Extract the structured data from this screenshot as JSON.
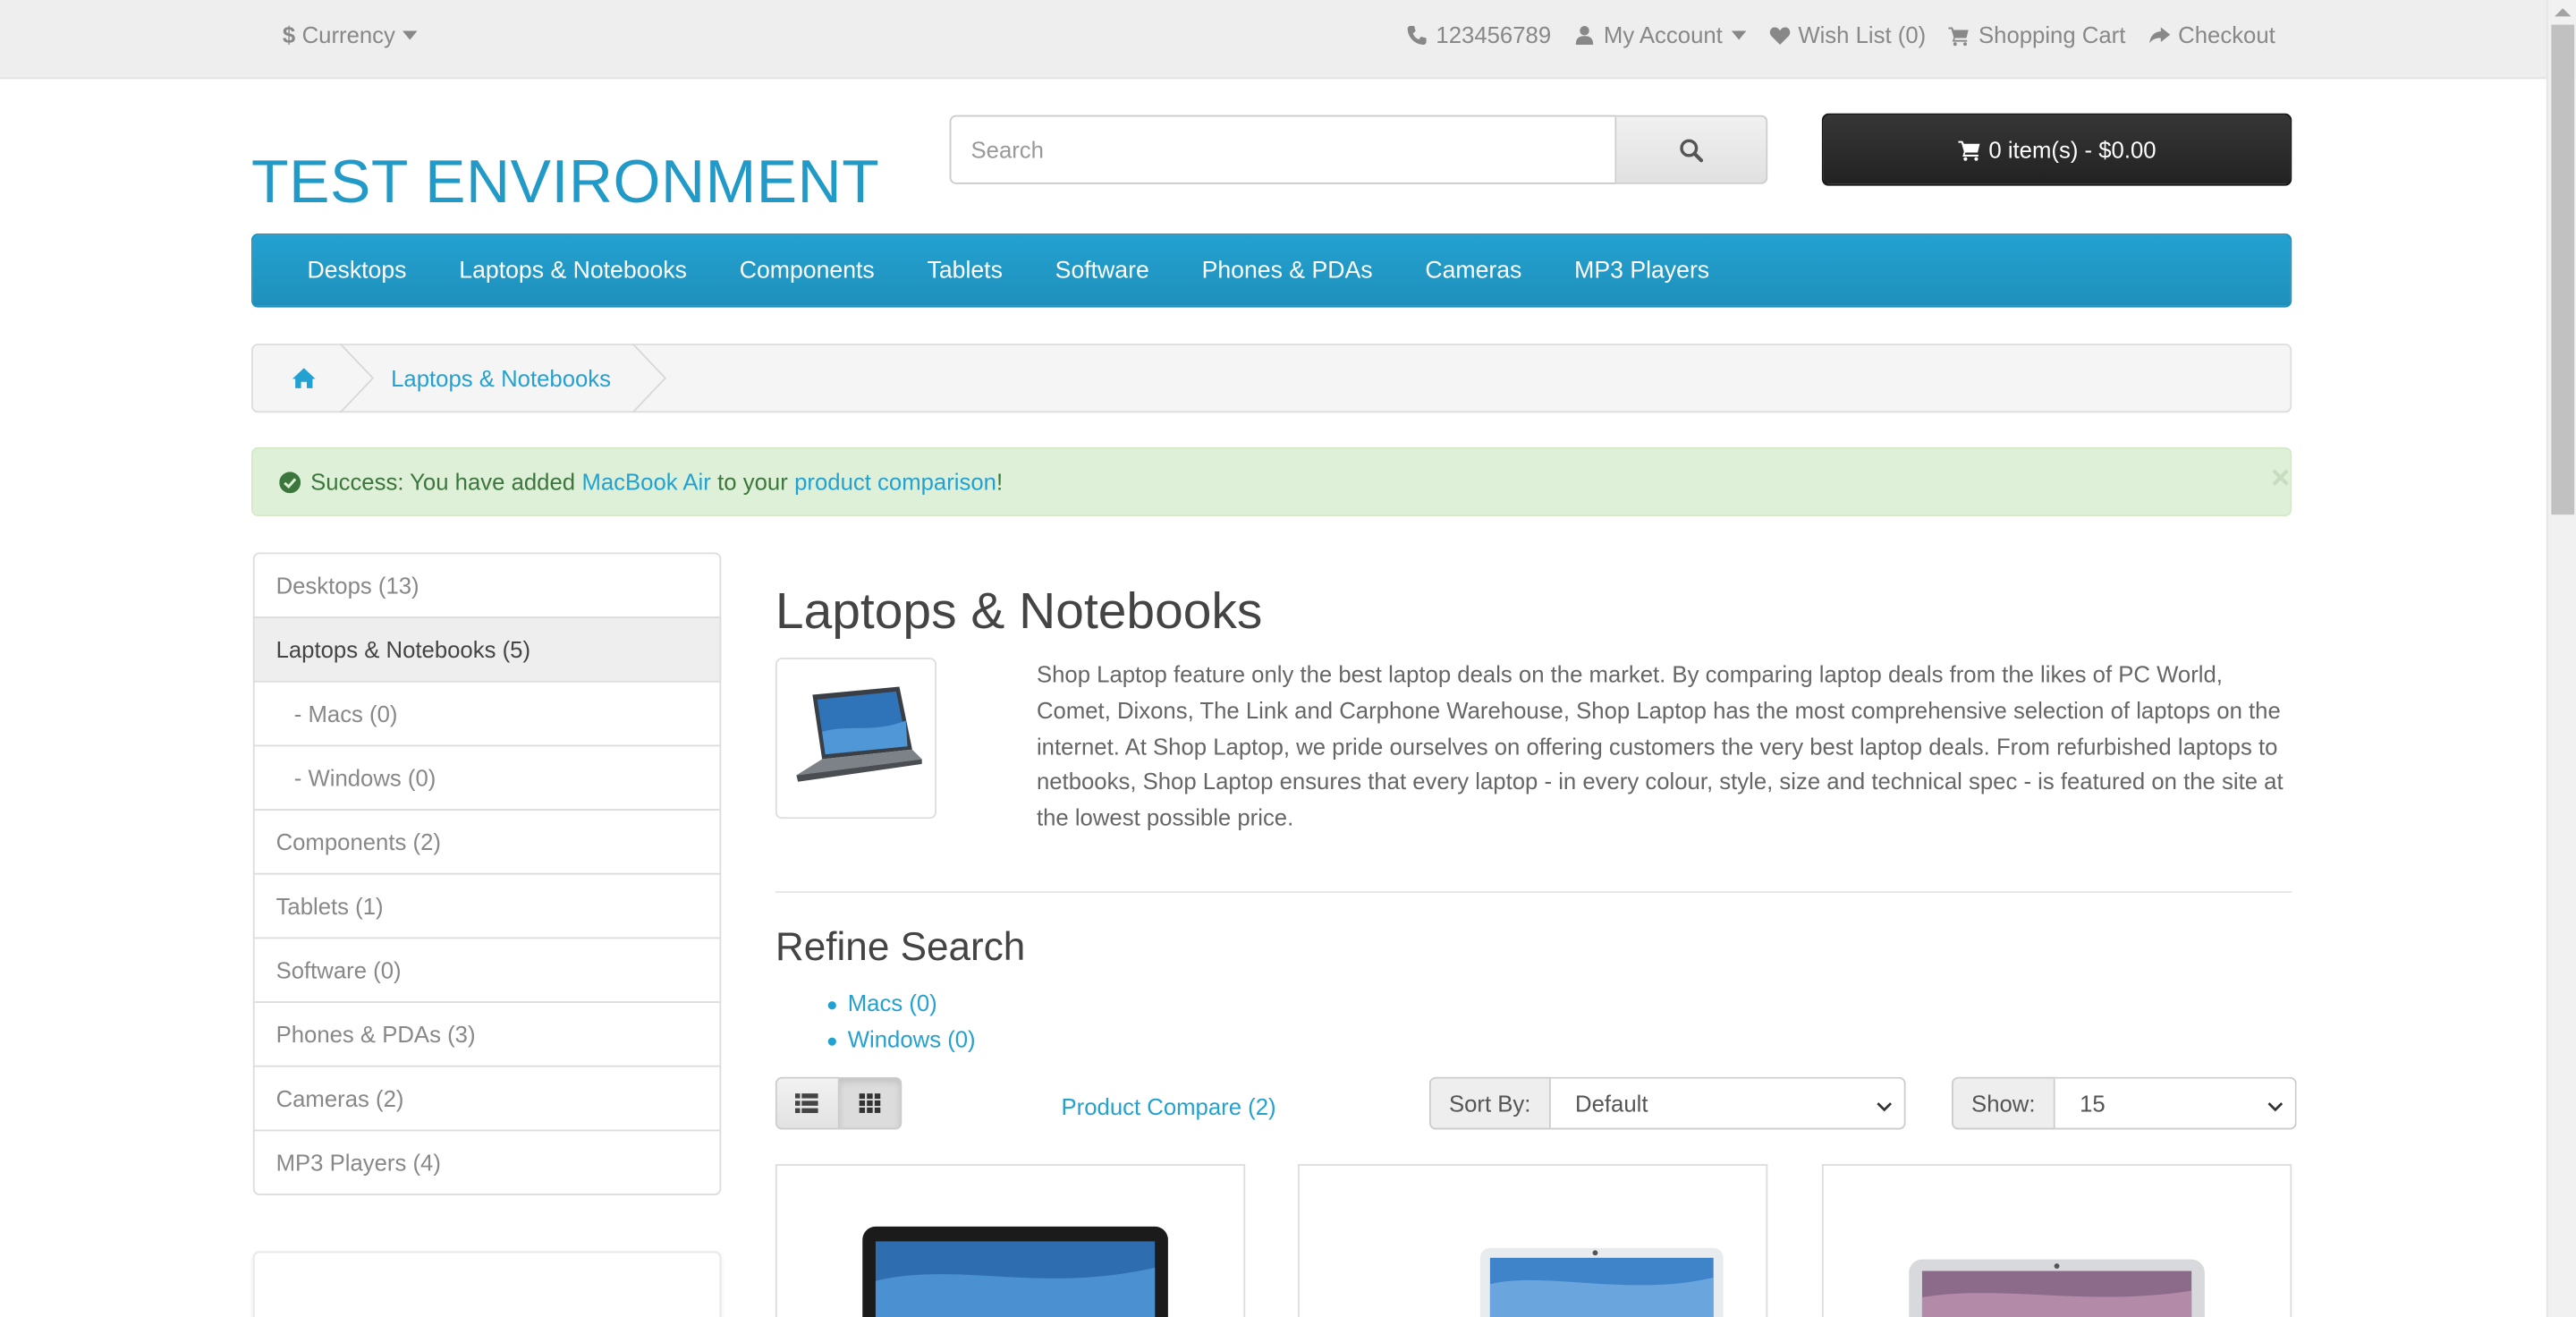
{
  "colors": {
    "accent": "#229ac8",
    "link": "#23a1d1",
    "menu_bg": "#229ac8",
    "cart_bg": "#303030",
    "alert_bg": "#dff0d8",
    "alert_text": "#3c763d"
  },
  "topbar": {
    "currency_icon": "dollar-icon",
    "currency_symbol": "$",
    "currency_label": "Currency",
    "phone": "123456789",
    "my_account": "My Account",
    "wishlist": "Wish List (0)",
    "shopping_cart": "Shopping Cart",
    "checkout": "Checkout"
  },
  "header": {
    "logo": "TEST ENVIRONMENT",
    "search_placeholder": "Search",
    "cart_label": "0 item(s) - $0.00"
  },
  "menu": {
    "items": [
      "Desktops",
      "Laptops & Notebooks",
      "Components",
      "Tablets",
      "Software",
      "Phones & PDAs",
      "Cameras",
      "MP3 Players"
    ]
  },
  "breadcrumb": {
    "home_icon": "home-icon",
    "current": "Laptops & Notebooks"
  },
  "alert": {
    "prefix": "Success: You have added",
    "product_link": "MacBook Air",
    "middle": "to your",
    "compare_link": "product comparison",
    "suffix": "!",
    "close": "×"
  },
  "sidebar": {
    "items": [
      {
        "label": "Desktops (13)"
      },
      {
        "label": "Laptops & Notebooks (5)"
      },
      {
        "label": "- Macs (0)"
      },
      {
        "label": "- Windows (0)"
      },
      {
        "label": "Components (2)"
      },
      {
        "label": "Tablets (1)"
      },
      {
        "label": "Software (0)"
      },
      {
        "label": "Phones & PDAs (3)"
      },
      {
        "label": "Cameras (2)"
      },
      {
        "label": "MP3 Players (4)"
      }
    ]
  },
  "main": {
    "title": "Laptops & Notebooks",
    "description": "Shop Laptop feature only the best laptop deals on the market. By comparing laptop deals from the likes of PC World, Comet, Dixons, The Link and Carphone Warehouse, Shop Laptop has the most comprehensive selection of laptops on the internet. At Shop Laptop, we pride ourselves on offering customers the very best laptop deals. From refurbished laptops to netbooks, Shop Laptop ensures that every laptop - in every colour, style, size and technical spec - is featured on the site at the lowest possible price.",
    "refine_title": "Refine Search",
    "refine_links": [
      "Macs (0)",
      "Windows (0)"
    ],
    "product_compare": "Product Compare (2)",
    "sort_label": "Sort By:",
    "sort_value": "Default",
    "show_label": "Show:",
    "show_value": "15"
  }
}
